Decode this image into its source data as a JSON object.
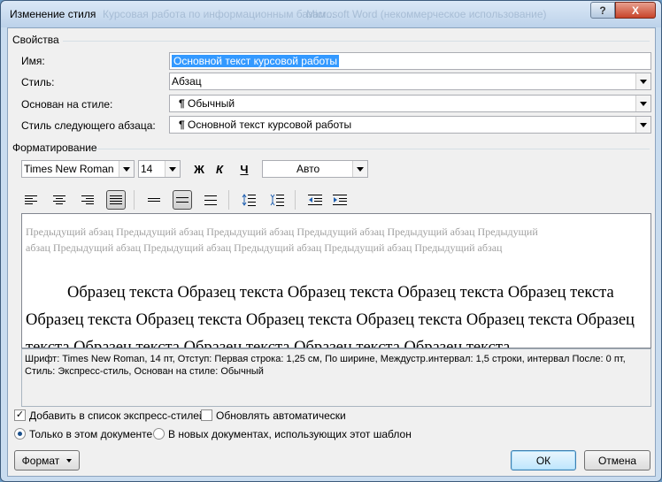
{
  "window": {
    "title": "Изменение стиля",
    "background_titles": [
      "Курсовая работа по информационным базам...",
      "Microsoft Word (некоммерческое использование)"
    ],
    "help_glyph": "?",
    "close_glyph": "X"
  },
  "properties": {
    "group_label": "Свойства",
    "name_label": "Имя:",
    "name_value": "Основной текст курсовой работы",
    "type_label": "Стиль:",
    "type_value": "Абзац",
    "based_label": "Основан на стиле:",
    "based_value": "Обычный",
    "next_label": "Стиль следующего абзаца:",
    "next_value": "Основной текст курсовой работы",
    "para_glyph": "¶"
  },
  "formatting": {
    "group_label": "Форматирование",
    "font": "Times New Roman",
    "size": "14",
    "bold": "Ж",
    "italic": "К",
    "underline": "Ч",
    "color": "Авто"
  },
  "preview": {
    "previous_paragraph": "Предыдущий абзац Предыдущий абзац Предыдущий абзац Предыдущий абзац Предыдущий абзац Предыдущий абзац Предыдущий абзац Предыдущий абзац Предыдущий абзац Предыдущий абзац Предыдущий абзац",
    "sample": "Образец текста Образец текста Образец текста Образец текста Образец текста Образец текста Образец текста Образец текста Образец текста Образец текста Образец текста Образец текста Образец текста Образец текста Образец текста"
  },
  "description": {
    "line1": "Шрифт: Times New Roman, 14 пт, Отступ: Первая строка:  1,25 см, По ширине, Междустр.интервал:  1,5 строки, интервал После:  0 пт,",
    "line2": "Стиль: Экспресс-стиль, Основан на стиле: Обычный"
  },
  "options": {
    "add_quick": "Добавить в список экспресс-стилей",
    "add_quick_checked": true,
    "auto_update": "Обновлять автоматически",
    "auto_update_checked": false,
    "only_doc": "Только в этом документе",
    "new_docs": "В новых документах, использующих этот шаблон",
    "selected_scope": "only_doc"
  },
  "buttons": {
    "format": "Формат",
    "ok": "ОК",
    "cancel": "Отмена"
  },
  "colors": {
    "accent": "#3399ff",
    "frame": "#c9dcef",
    "close": "#c7442a"
  }
}
